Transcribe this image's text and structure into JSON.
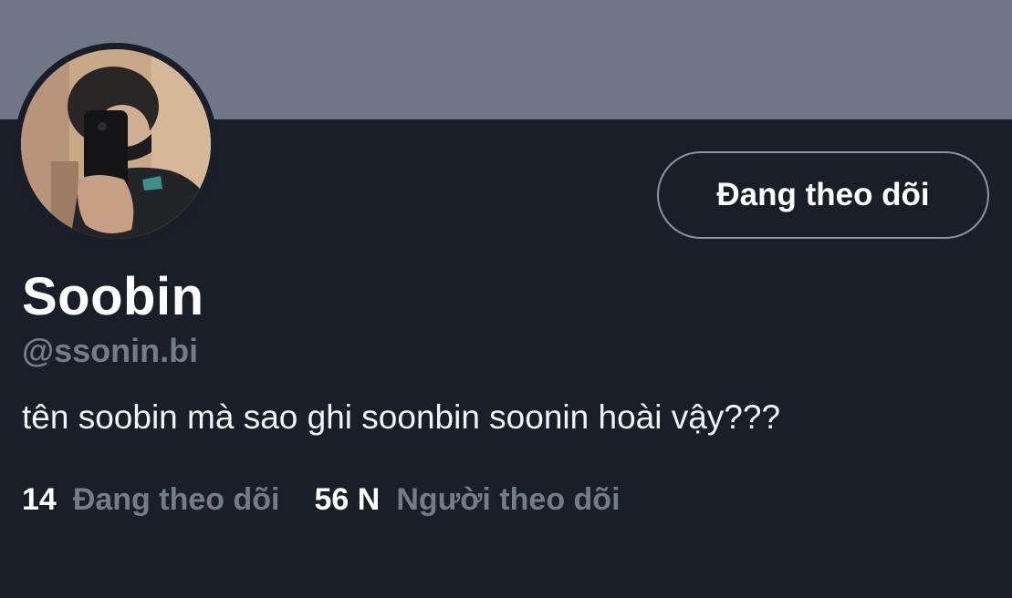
{
  "profile": {
    "display_name": "Soobin",
    "handle": "@ssonin.bi",
    "bio": "tên soobin mà sao ghi soonbin soonin hoài vậy???",
    "follow_button_label": "Đang theo dõi",
    "stats": [
      {
        "count": "14",
        "label": "Đang theo dõi"
      },
      {
        "count": "56 N",
        "label": "Người theo dõi"
      }
    ]
  },
  "colors": {
    "banner": "#6e7888",
    "background": "#1a1e29",
    "muted_text": "#737c89",
    "primary_text": "#ffffff"
  },
  "icons": {
    "avatar": "profile-photo"
  }
}
